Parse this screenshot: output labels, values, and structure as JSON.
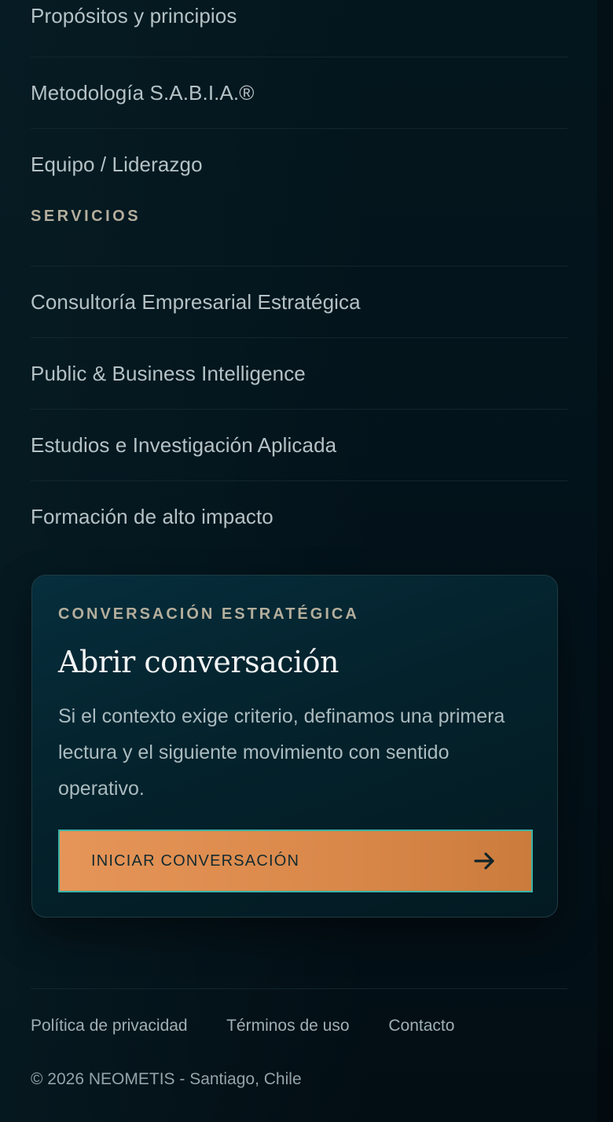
{
  "nav": {
    "about_items": [
      "Propósitos y principios",
      "Metodología S.A.B.I.A.®",
      "Equipo / Liderazgo"
    ],
    "services_label": "SERVICIOS",
    "service_items": [
      "Consultoría Empresarial Estratégica",
      "Public & Business Intelligence",
      "Estudios e Investigación Aplicada",
      "Formación de alto impacto"
    ]
  },
  "cta": {
    "kicker": "CONVERSACIÓN ESTRATÉGICA",
    "title": "Abrir conversación",
    "text": "Si el contexto exige criterio, definamos una primera lectura y el siguiente movimiento con sentido operativo.",
    "button_label": "INICIAR CONVERSACIÓN",
    "button_icon": "arrow-right-icon"
  },
  "footer": {
    "links": [
      "Política de privacidad",
      "Términos de uso",
      "Contacto"
    ],
    "copyright": "© 2026 NEOMETIS - Santiago, Chile"
  },
  "colors": {
    "background": "#03141a",
    "accent": "#e69558",
    "button_border": "#3bb3a5",
    "section_label": "#b4ae9c"
  }
}
